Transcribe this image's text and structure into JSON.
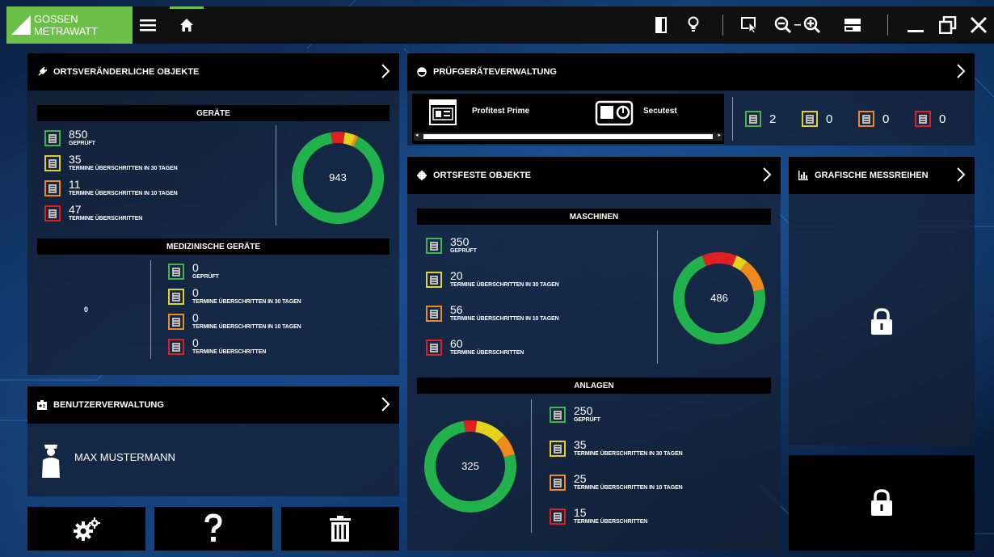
{
  "topbar": {
    "logo_text": "GOSSEN METRAWATT",
    "icons": [
      "menu-icon",
      "home-icon",
      "door-icon",
      "lightbulb-icon",
      "select-cursor-icon",
      "zoom-out-icon",
      "zoom-in-icon",
      "window-layout-icon",
      "minimize-icon",
      "restore-icon",
      "close-icon"
    ]
  },
  "ortsveraenderlich": {
    "title": "ORTSVERÄNDERLICHE OBJEKTE",
    "geraete": {
      "title": "GERÄTE",
      "total": "943",
      "stats": [
        {
          "num": "850",
          "label": "GEPRÜFT",
          "color": "#3fb54a"
        },
        {
          "num": "35",
          "label": "TERMINE ÜBERSCHRITTEN IN 30 TAGEN",
          "color": "#e5d21e"
        },
        {
          "num": "11",
          "label": "TERMINE ÜBERSCHRITTEN IN 10 TAGEN",
          "color": "#f08a1c"
        },
        {
          "num": "47",
          "label": "TERMINE ÜBERSCHRITTEN",
          "color": "#e02020"
        }
      ]
    },
    "medizin": {
      "title": "MEDIZINISCHE GERÄTE",
      "total": "0",
      "stats": [
        {
          "num": "0",
          "label": "GEPRÜFT",
          "color": "#3fb54a"
        },
        {
          "num": "0",
          "label": "TERMINE ÜBERSCHRITTEN IN 30 TAGEN",
          "color": "#e5d21e"
        },
        {
          "num": "0",
          "label": "TERMINE ÜBERSCHRITTEN IN 10 TAGEN",
          "color": "#f08a1c"
        },
        {
          "num": "0",
          "label": "TERMINE ÜBERSCHRITTEN",
          "color": "#e02020"
        }
      ]
    }
  },
  "benutzer": {
    "title": "BENUTZERVERWALTUNG",
    "user_name": "MAX MUSTERMANN"
  },
  "pruefgeraete": {
    "title": "PRÜFGERÄTEVERWALTUNG",
    "devices": [
      "Profitest Prime",
      "Secutest"
    ],
    "counts": [
      {
        "num": "2",
        "color": "#3fb54a"
      },
      {
        "num": "0",
        "color": "#e5d21e"
      },
      {
        "num": "0",
        "color": "#f08a1c"
      },
      {
        "num": "0",
        "color": "#e02020"
      }
    ]
  },
  "ortsfest": {
    "title": "ORTSFESTE OBJEKTE",
    "maschinen": {
      "title": "MASCHINEN",
      "total": "486",
      "stats": [
        {
          "num": "350",
          "label": "GEPRÜFT",
          "color": "#3fb54a"
        },
        {
          "num": "20",
          "label": "TERMINE ÜBERSCHRITTEN IN 30 TAGEN",
          "color": "#e5d21e"
        },
        {
          "num": "56",
          "label": "TERMINE ÜBERSCHRITTEN IN 10 TAGEN",
          "color": "#f08a1c"
        },
        {
          "num": "60",
          "label": "TERMINE ÜBERSCHRITTEN",
          "color": "#e02020"
        }
      ]
    },
    "anlagen": {
      "title": "ANLAGEN",
      "total": "325",
      "stats": [
        {
          "num": "250",
          "label": "GEPRÜFT",
          "color": "#3fb54a"
        },
        {
          "num": "35",
          "label": "TERMINE ÜBERSCHRITTEN IN 30 TAGEN",
          "color": "#e5d21e"
        },
        {
          "num": "25",
          "label": "TERMINE ÜBERSCHRITTEN IN 10 TAGEN",
          "color": "#f08a1c"
        },
        {
          "num": "15",
          "label": "TERMINE ÜBERSCHRITTEN",
          "color": "#e02020"
        }
      ]
    }
  },
  "grafisch": {
    "title": "GRAFISCHE MESSREIHEN"
  },
  "bottom_buttons": [
    "settings-gears-icon",
    "help-question-icon",
    "trash-icon"
  ]
}
